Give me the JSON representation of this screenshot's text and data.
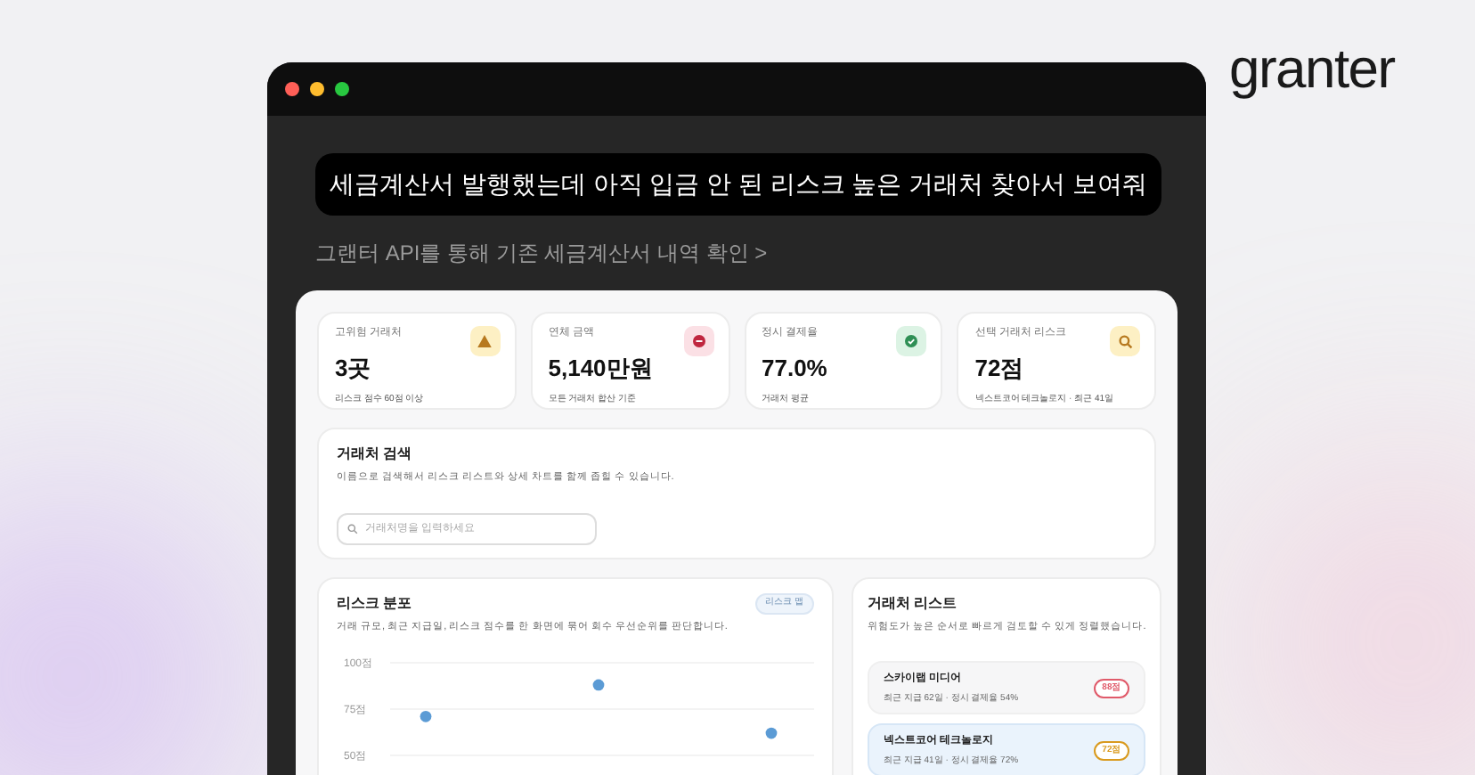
{
  "brand": {
    "logo": "granter"
  },
  "window": {
    "controls": [
      {
        "kind": "close"
      },
      {
        "kind": "minimize"
      },
      {
        "kind": "zoom"
      }
    ]
  },
  "prompt": "세금계산서 발행했는데 아직 입금 안 된 리스크 높은 거래처 찾아서 보여줘",
  "api_link": "그랜터 API를 통해 기존 세금계산서 내역 확인 >",
  "stats": [
    {
      "label": "고위험 거래처",
      "value": "3곳",
      "note": "리스크 점수 60점 이상",
      "kind": "warning"
    },
    {
      "label": "연체 금액",
      "value": "5,140만원",
      "note": "모든 거래처 합산 기준",
      "kind": "overdue"
    },
    {
      "label": "정시 결제율",
      "value": "77.0%",
      "note": "거래처 평균",
      "kind": "ok"
    },
    {
      "label": "선택 거래처 리스크",
      "value": "72점",
      "note": "넥스트코어 테크놀로지 · 최근 41일",
      "kind": "search"
    }
  ],
  "search": {
    "title": "거래처 검색",
    "description": "이름으로 검색해서 리스크 리스트와 상세 차트를 함께 좁힐 수 있습니다.",
    "placeholder": "거래처명을 입력하세요"
  },
  "risk_chart": {
    "title": "리스크 분포",
    "badge": "리스크 맵",
    "description": "거래 규모, 최근 지급일, 리스크 점수를 한 화면에 묶어 회수 우선순위를 판단합니다.",
    "chart_data": {
      "type": "scatter",
      "ylim": [
        50,
        100
      ],
      "yticks": [
        {
          "value": 100,
          "label": "100점"
        },
        {
          "value": 75,
          "label": "75점"
        },
        {
          "value": 50,
          "label": "50점"
        }
      ],
      "series": [
        {
          "color": "#5b9bd5",
          "values": [
            71,
            88,
            62
          ]
        }
      ]
    }
  },
  "partners": {
    "title": "거래처 리스트",
    "description": "위험도가 높은 순서로 빠르게 검토할 수 있게 정렬했습니다.",
    "items": [
      {
        "name": "스카이랩 미디어",
        "meta": "최근 지급 62일 · 정시 결제율 54%",
        "score": "88점",
        "color": "#e05a6a",
        "selected": false
      },
      {
        "name": "넥스트코어 테크놀로지",
        "meta": "최근 지급 41일 · 정시 결제율 72%",
        "score": "72점",
        "color": "#d99a1e",
        "selected": true
      }
    ]
  }
}
